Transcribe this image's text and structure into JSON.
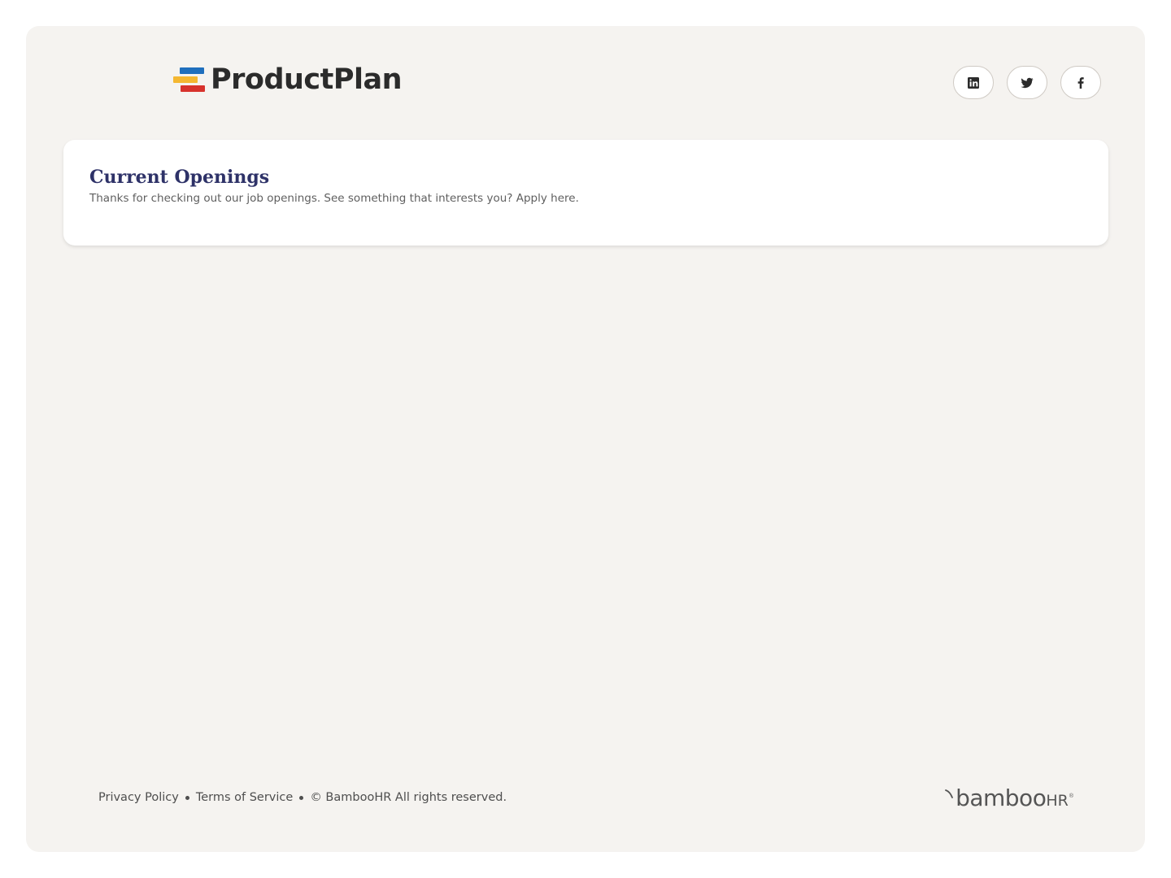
{
  "brand": {
    "name": "ProductPlan",
    "colors": {
      "blue": "#1f6fbd",
      "yellow": "#f4b731",
      "red": "#d7322c"
    }
  },
  "social": [
    {
      "name": "linkedin",
      "icon": "linkedin-icon"
    },
    {
      "name": "twitter",
      "icon": "twitter-icon"
    },
    {
      "name": "facebook",
      "icon": "facebook-icon"
    }
  ],
  "openings": {
    "title": "Current Openings",
    "subtitle": "Thanks for checking out our job openings. See something that interests you? Apply here."
  },
  "footer": {
    "privacy": "Privacy Policy",
    "terms": "Terms of Service",
    "copyright": "© BambooHR All rights reserved."
  },
  "powered_by": {
    "main": "bamboo",
    "suffix": "HR",
    "trademark": "®"
  },
  "colors": {
    "page_background": "#f5f3f0",
    "card_background": "#ffffff",
    "title": "#2e3268",
    "text": "#5f5f5f"
  }
}
